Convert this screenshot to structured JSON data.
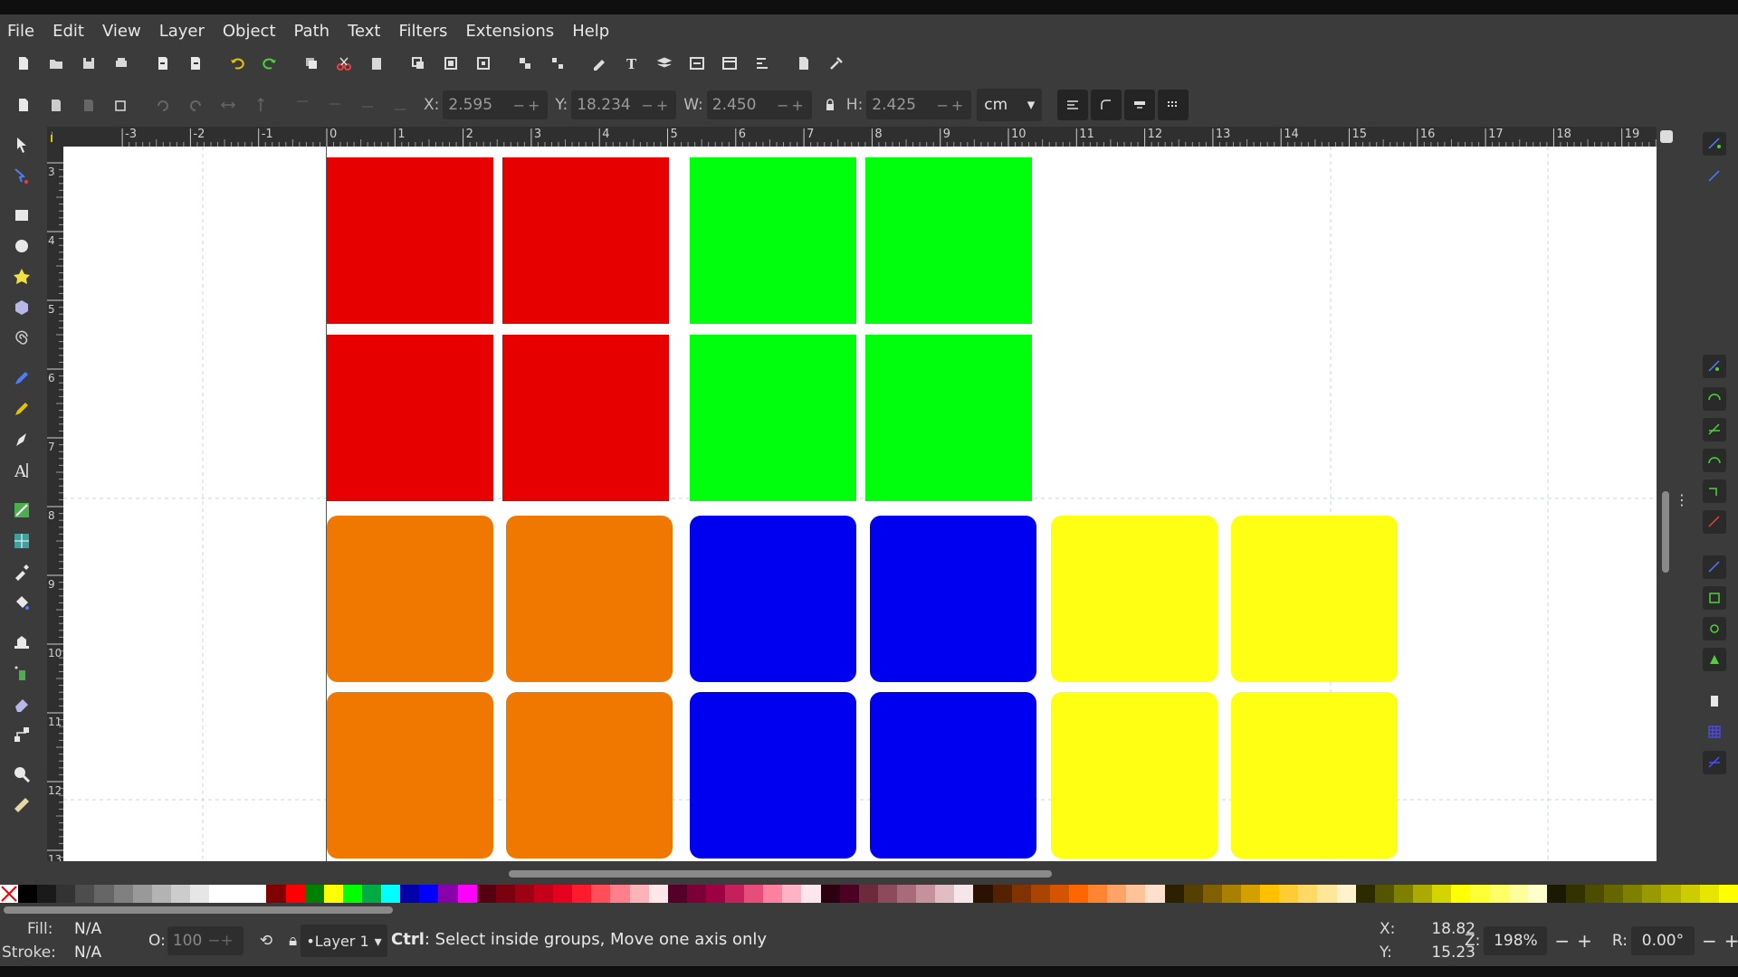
{
  "menu": [
    "File",
    "Edit",
    "View",
    "Layer",
    "Object",
    "Path",
    "Text",
    "Filters",
    "Extensions",
    "Help"
  ],
  "toolbar": {
    "x_label": "X:",
    "x_value": "2.595",
    "y_label": "Y:",
    "y_value": "18.234",
    "w_label": "W:",
    "w_value": "2.450",
    "h_label": "H:",
    "h_value": "2.425",
    "unit": "cm"
  },
  "ruler": {
    "h_ticks": [
      "-3",
      "-2",
      "-1",
      "0",
      "1",
      "2",
      "3",
      "4",
      "5",
      "6",
      "7",
      "8",
      "9",
      "10",
      "11",
      "12",
      "13",
      "14",
      "15",
      "16",
      "17",
      "18",
      "19"
    ],
    "v_ticks": [
      "3",
      "4",
      "5",
      "6",
      "7",
      "8",
      "9",
      "10",
      "11",
      "12",
      "13"
    ]
  },
  "canvas": {
    "colors": {
      "red": "#e60000",
      "green": "#00ff0c",
      "orange": "#f07800",
      "blue": "#0000f0",
      "yellow": "#ffff14"
    }
  },
  "palette": [
    "#000000",
    "#1a1a1a",
    "#333333",
    "#4d4d4d",
    "#666666",
    "#808080",
    "#999999",
    "#b3b3b3",
    "#cccccc",
    "#e6e6e6",
    "#ffffff",
    "#ffffff",
    "#ffffff",
    "#800000",
    "#ff0000",
    "#008000",
    "#ffff00",
    "#00ff00",
    "#00aa44",
    "#00ffff",
    "#0000aa",
    "#0000ff",
    "#8800aa",
    "#ff00ff",
    "#55000e",
    "#7a0010",
    "#9e0014",
    "#c4001b",
    "#e6001f",
    "#ff1a2e",
    "#ff4d5a",
    "#ff808a",
    "#ffb3b8",
    "#ffe6e8",
    "#550028",
    "#7a0035",
    "#9e0044",
    "#c4215a",
    "#e64d7a",
    "#ff809f",
    "#ffb3c4",
    "#ffe6ec",
    "#2b0011",
    "#4d0021",
    "#6e2a3d",
    "#8c4a5c",
    "#a86b7b",
    "#c4919c",
    "#e0bcc3",
    "#f5e6e9",
    "#2b1100",
    "#552200",
    "#803300",
    "#aa4400",
    "#d45500",
    "#ff6600",
    "#ff8533",
    "#ffa366",
    "#ffc299",
    "#ffe0cc",
    "#2b2000",
    "#554000",
    "#806000",
    "#aa8000",
    "#d4a000",
    "#ffc000",
    "#ffcc33",
    "#ffd966",
    "#ffe699",
    "#fff2cc",
    "#2b2b00",
    "#555500",
    "#808000",
    "#aaaa00",
    "#d4d400",
    "#ffff00",
    "#ffff33",
    "#ffff66",
    "#ffff99",
    "#ffffcc",
    "#1a1a00",
    "#333300",
    "#4d4d00",
    "#666600",
    "#808000",
    "#999900",
    "#b3b300",
    "#cccc00",
    "#e6e600",
    "#ffff00"
  ],
  "status": {
    "fill_label": "Fill:",
    "fill_value": "N/A",
    "stroke_label": "Stroke:",
    "stroke_value": "N/A",
    "opacity_label": "O:",
    "opacity_value": "100",
    "layer": "•Layer 1",
    "msg_key": "Ctrl",
    "msg_text": ": Select inside groups, Move one axis only",
    "cx_label": "X:",
    "cx_value": "18.82",
    "cy_label": "Y:",
    "cy_value": "15.23",
    "zoom_label": "Z:",
    "zoom_value": "198%",
    "rot_label": "R:",
    "rot_value": "0.00°"
  }
}
